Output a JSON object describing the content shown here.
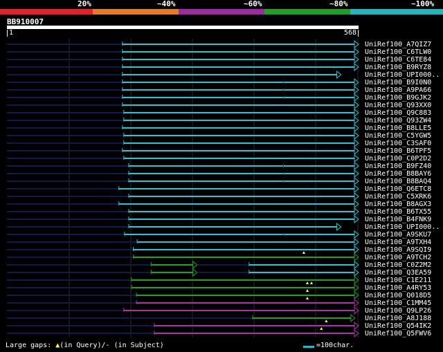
{
  "scale": {
    "segments": [
      {
        "label": "20%",
        "color": "#e8202a"
      },
      {
        "label": "~40%",
        "color": "#e87a20"
      },
      {
        "label": "~60%",
        "color": "#a02aa0"
      },
      {
        "label": "~80%",
        "color": "#20a020"
      },
      {
        "label": "~100%",
        "color": "#20b8c0"
      }
    ]
  },
  "query": {
    "id": "BB910007",
    "start": "1",
    "end": "568",
    "length": 568
  },
  "colors": {
    "cyan": "#20c8d8",
    "green": "#1aa81a",
    "magenta": "#b030b0",
    "navy": "#101a50",
    "grid": "#2a2a2a",
    "gap_marker": "#ffff40"
  },
  "hits": [
    {
      "label": "UniRef100_A7QIZ7",
      "segments": [
        {
          "s": 329,
          "e": 1000,
          "c": "cyan"
        }
      ],
      "ticks": []
    },
    {
      "label": "UniRef100_C6TLW0",
      "segments": [
        {
          "s": 329,
          "e": 1000,
          "c": "cyan"
        }
      ],
      "ticks": []
    },
    {
      "label": "UniRef100_C6TE84",
      "segments": [
        {
          "s": 329,
          "e": 1000,
          "c": "cyan"
        }
      ],
      "ticks": []
    },
    {
      "label": "UniRef100_B9RYZ8",
      "segments": [
        {
          "s": 329,
          "e": 1000,
          "c": "cyan"
        }
      ],
      "ticks": []
    },
    {
      "label": "UniRef100_UPI000..",
      "segments": [
        {
          "s": 329,
          "e": 950,
          "c": "cyan"
        }
      ],
      "ticks": []
    },
    {
      "label": "UniRef100_B9I0N0",
      "segments": [
        {
          "s": 329,
          "e": 1000,
          "c": "cyan"
        }
      ],
      "ticks": [
        788
      ]
    },
    {
      "label": "UniRef100_A9PA66",
      "segments": [
        {
          "s": 329,
          "e": 1000,
          "c": "cyan"
        }
      ],
      "ticks": [
        788
      ]
    },
    {
      "label": "UniRef100_B9GJK2",
      "segments": [
        {
          "s": 329,
          "e": 1000,
          "c": "cyan"
        }
      ],
      "ticks": [
        788
      ]
    },
    {
      "label": "UniRef100_Q93XX0",
      "segments": [
        {
          "s": 329,
          "e": 1000,
          "c": "cyan"
        }
      ],
      "ticks": []
    },
    {
      "label": "UniRef100_Q9C883",
      "segments": [
        {
          "s": 333,
          "e": 1000,
          "c": "cyan"
        }
      ],
      "ticks": []
    },
    {
      "label": "UniRef100_Q93ZW4",
      "segments": [
        {
          "s": 333,
          "e": 1000,
          "c": "cyan"
        }
      ],
      "ticks": []
    },
    {
      "label": "UniRef100_B8LLE5",
      "segments": [
        {
          "s": 329,
          "e": 1000,
          "c": "cyan"
        }
      ],
      "ticks": []
    },
    {
      "label": "UniRef100_C5YGW5",
      "segments": [
        {
          "s": 333,
          "e": 1000,
          "c": "cyan"
        }
      ],
      "ticks": []
    },
    {
      "label": "UniRef100_C3SAF0",
      "segments": [
        {
          "s": 333,
          "e": 1000,
          "c": "cyan"
        }
      ],
      "ticks": []
    },
    {
      "label": "UniRef100_B6TPF5",
      "segments": [
        {
          "s": 329,
          "e": 1000,
          "c": "cyan"
        }
      ],
      "ticks": []
    },
    {
      "label": "UniRef100_C0P2D2",
      "segments": [
        {
          "s": 333,
          "e": 1000,
          "c": "cyan"
        }
      ],
      "ticks": []
    },
    {
      "label": "UniRef100_B9FZ40",
      "segments": [
        {
          "s": 347,
          "e": 1000,
          "c": "cyan"
        }
      ],
      "ticks": [
        788
      ]
    },
    {
      "label": "UniRef100_B8BAY6",
      "segments": [
        {
          "s": 347,
          "e": 1000,
          "c": "cyan"
        }
      ],
      "ticks": [
        788
      ]
    },
    {
      "label": "UniRef100_B8BAQ4",
      "segments": [
        {
          "s": 347,
          "e": 1000,
          "c": "cyan"
        }
      ],
      "ticks": [
        788
      ]
    },
    {
      "label": "UniRef100_Q6ETC8",
      "segments": [
        {
          "s": 319,
          "e": 1000,
          "c": "cyan"
        }
      ],
      "ticks": []
    },
    {
      "label": "UniRef100_C5XRK6",
      "segments": [
        {
          "s": 347,
          "e": 1000,
          "c": "cyan"
        }
      ],
      "ticks": []
    },
    {
      "label": "UniRef100_B8AGX3",
      "segments": [
        {
          "s": 319,
          "e": 1000,
          "c": "cyan"
        }
      ],
      "ticks": []
    },
    {
      "label": "UniRef100_B6TX55",
      "segments": [
        {
          "s": 347,
          "e": 1000,
          "c": "cyan"
        }
      ],
      "ticks": []
    },
    {
      "label": "UniRef100_B4FNK9",
      "segments": [
        {
          "s": 347,
          "e": 1000,
          "c": "cyan"
        }
      ],
      "ticks": []
    },
    {
      "label": "UniRef100_UPI000..",
      "segments": [
        {
          "s": 347,
          "e": 950,
          "c": "cyan"
        }
      ],
      "ticks": []
    },
    {
      "label": "UniRef100_A9SKU7",
      "segments": [
        {
          "s": 335,
          "e": 1000,
          "c": "cyan"
        }
      ],
      "ticks": [
        788
      ]
    },
    {
      "label": "UniRef100_A9TXH4",
      "segments": [
        {
          "s": 371,
          "e": 1000,
          "c": "cyan"
        }
      ],
      "ticks": []
    },
    {
      "label": "UniRef100_A9SQI9",
      "segments": [
        {
          "s": 360,
          "e": 1000,
          "c": "cyan"
        }
      ],
      "ticks": []
    },
    {
      "label": "UniRef100_A9TCH2",
      "segments": [
        {
          "s": 360,
          "e": 1000,
          "c": "green"
        }
      ],
      "ticks": [
        846
      ],
      "gaps": [
        846
      ]
    },
    {
      "label": "UniRef100_C0Z2M2",
      "segments": [
        {
          "s": 411,
          "e": 540,
          "c": "green"
        },
        {
          "s": 690,
          "e": 1000,
          "c": "cyan"
        }
      ],
      "ticks": []
    },
    {
      "label": "UniRef100_Q3EA59",
      "segments": [
        {
          "s": 411,
          "e": 540,
          "c": "green"
        },
        {
          "s": 690,
          "e": 1000,
          "c": "cyan"
        }
      ],
      "ticks": []
    },
    {
      "label": "UniRef100_C1E211",
      "segments": [
        {
          "s": 355,
          "e": 1000,
          "c": "green"
        }
      ],
      "ticks": []
    },
    {
      "label": "UniRef100_A4RY53",
      "segments": [
        {
          "s": 355,
          "e": 1000,
          "c": "green"
        }
      ],
      "ticks": [],
      "gaps": [
        856,
        868
      ]
    },
    {
      "label": "UniRef100_Q018D5",
      "segments": [
        {
          "s": 369,
          "e": 1000,
          "c": "green"
        }
      ],
      "ticks": [],
      "gaps": [
        856
      ]
    },
    {
      "label": "UniRef100_C1MM45",
      "segments": [
        {
          "s": 369,
          "e": 1000,
          "c": "magenta"
        }
      ],
      "ticks": [],
      "gaps": [
        856
      ]
    },
    {
      "label": "UniRef100_Q9LP26",
      "segments": [
        {
          "s": 333,
          "e": 1000,
          "c": "magenta"
        }
      ],
      "ticks": []
    },
    {
      "label": "UniRef100_A8J188",
      "segments": [
        {
          "s": 700,
          "e": 990,
          "c": "green"
        }
      ],
      "ticks": []
    },
    {
      "label": "UniRef100_Q54IK2",
      "segments": [
        {
          "s": 420,
          "e": 1000,
          "c": "magenta"
        }
      ],
      "ticks": [],
      "gaps": [
        910
      ]
    },
    {
      "label": "UniRef100_Q5FWV6",
      "segments": [
        {
          "s": 420,
          "e": 1000,
          "c": "magenta"
        }
      ],
      "ticks": [],
      "gaps": [
        896
      ]
    }
  ],
  "legend": {
    "gaps_prefix": "Large gaps:",
    "gaps_query": "(in Query)/",
    "gaps_dash": "-",
    "gaps_subject": " (in Subject)",
    "scale_text": "=100char."
  }
}
